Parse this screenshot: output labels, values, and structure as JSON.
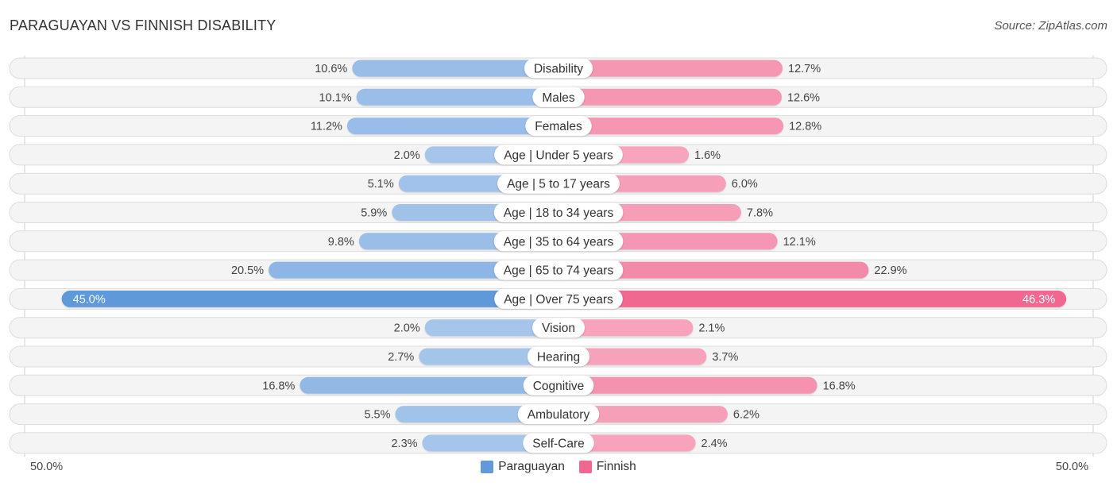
{
  "header": {
    "title": "PARAGUAYAN VS FINNISH DISABILITY",
    "source": "Source: ZipAtlas.com"
  },
  "axis": {
    "left_label": "50.0%",
    "right_label": "50.0%"
  },
  "legend": {
    "items": [
      {
        "name": "Paraguayan",
        "color": "#6199d9"
      },
      {
        "name": "Finnish",
        "color": "#f06890"
      }
    ]
  },
  "colors": {
    "paraguayan_strong": "#6199d9",
    "paraguayan_light": "#a8c7eb",
    "finnish_strong": "#f06890",
    "finnish_light": "#f7a6be"
  },
  "chart_data": {
    "type": "bar",
    "orientation": "diverging-horizontal",
    "title": "PARAGUAYAN VS FINNISH DISABILITY",
    "xlabel": "",
    "ylabel": "",
    "xlim": [
      -50,
      50
    ],
    "legend_position": "bottom",
    "categories": [
      "Disability",
      "Males",
      "Females",
      "Age | Under 5 years",
      "Age | 5 to 17 years",
      "Age | 18 to 34 years",
      "Age | 35 to 64 years",
      "Age | 65 to 74 years",
      "Age | Over 75 years",
      "Vision",
      "Hearing",
      "Cognitive",
      "Ambulatory",
      "Self-Care"
    ],
    "series": [
      {
        "name": "Paraguayan",
        "side": "left",
        "values": [
          10.6,
          10.1,
          11.2,
          2.0,
          5.1,
          5.9,
          9.8,
          20.5,
          45.0,
          2.0,
          2.7,
          16.8,
          5.5,
          2.3
        ],
        "labels": [
          "10.6%",
          "10.1%",
          "11.2%",
          "2.0%",
          "5.1%",
          "5.9%",
          "9.8%",
          "20.5%",
          "45.0%",
          "2.0%",
          "2.7%",
          "16.8%",
          "5.5%",
          "2.3%"
        ]
      },
      {
        "name": "Finnish",
        "side": "right",
        "values": [
          12.7,
          12.6,
          12.8,
          1.6,
          6.0,
          7.8,
          12.1,
          22.9,
          46.3,
          2.1,
          3.7,
          16.8,
          6.2,
          2.4
        ],
        "labels": [
          "12.7%",
          "12.6%",
          "12.8%",
          "1.6%",
          "6.0%",
          "7.8%",
          "12.1%",
          "22.9%",
          "46.3%",
          "2.1%",
          "3.7%",
          "16.8%",
          "6.2%",
          "2.4%"
        ]
      }
    ],
    "axis_tick_labels": [
      "50.0%",
      "50.0%"
    ],
    "grid": false
  }
}
